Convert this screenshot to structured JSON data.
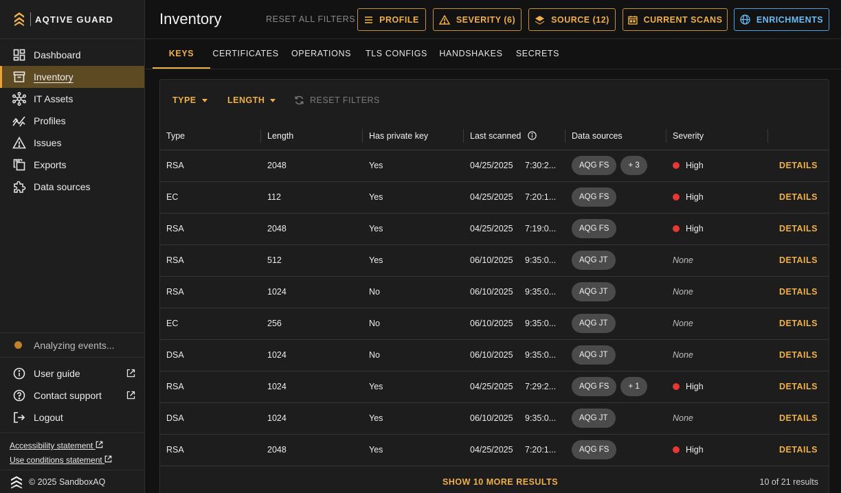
{
  "brand": {
    "name": "AQTIVE GUARD"
  },
  "sidebar": {
    "items": [
      {
        "label": "Dashboard",
        "icon": "dashboard-icon"
      },
      {
        "label": "Inventory",
        "icon": "archive-icon",
        "active": true
      },
      {
        "label": "IT Assets",
        "icon": "network-icon"
      },
      {
        "label": "Profiles",
        "icon": "chart-icon"
      },
      {
        "label": "Issues",
        "icon": "warning-icon"
      },
      {
        "label": "Exports",
        "icon": "copy-icon"
      },
      {
        "label": "Data sources",
        "icon": "puzzle-icon"
      }
    ],
    "status": "Analyzing events...",
    "bottom": [
      {
        "label": "User guide",
        "icon": "info-icon"
      },
      {
        "label": "Contact support",
        "icon": "help-icon"
      },
      {
        "label": "Logout",
        "icon": "logout-icon"
      }
    ],
    "legal": [
      "Accessibility statement",
      "Use conditions statement"
    ],
    "copyright": "© 2025 SandboxAQ"
  },
  "header": {
    "title": "Inventory",
    "reset_all": "RESET ALL FILTERS",
    "buttons": {
      "profile": "PROFILE",
      "severity": "SEVERITY (6)",
      "source": "SOURCE (12)",
      "scans": "CURRENT SCANS",
      "enrichments": "ENRICHMENTS"
    }
  },
  "tabs": [
    "KEYS",
    "CERTIFICATES",
    "OPERATIONS",
    "TLS CONFIGS",
    "HANDSHAKES",
    "SECRETS"
  ],
  "filters": {
    "type": "TYPE",
    "length": "LENGTH",
    "reset": "RESET FILTERS"
  },
  "table": {
    "columns": [
      "Type",
      "Length",
      "Has private key",
      "Last scanned",
      "Data sources",
      "Severity"
    ],
    "details_label": "DETAILS",
    "rows": [
      {
        "type": "RSA",
        "length": "2048",
        "private": "Yes",
        "date": "04/25/2025",
        "time": "7:30:2...",
        "sources": [
          "AQG FS",
          "+ 3"
        ],
        "severity": "High"
      },
      {
        "type": "EC",
        "length": "112",
        "private": "Yes",
        "date": "04/25/2025",
        "time": "7:20:1...",
        "sources": [
          "AQG FS"
        ],
        "severity": "High"
      },
      {
        "type": "RSA",
        "length": "2048",
        "private": "Yes",
        "date": "04/25/2025",
        "time": "7:19:0...",
        "sources": [
          "AQG FS"
        ],
        "severity": "High"
      },
      {
        "type": "RSA",
        "length": "512",
        "private": "Yes",
        "date": "06/10/2025",
        "time": "9:35:0...",
        "sources": [
          "AQG JT"
        ],
        "severity": "None"
      },
      {
        "type": "RSA",
        "length": "1024",
        "private": "No",
        "date": "06/10/2025",
        "time": "9:35:0...",
        "sources": [
          "AQG JT"
        ],
        "severity": "None"
      },
      {
        "type": "EC",
        "length": "256",
        "private": "No",
        "date": "06/10/2025",
        "time": "9:35:0...",
        "sources": [
          "AQG JT"
        ],
        "severity": "None"
      },
      {
        "type": "DSA",
        "length": "1024",
        "private": "No",
        "date": "06/10/2025",
        "time": "9:35:0...",
        "sources": [
          "AQG JT"
        ],
        "severity": "None"
      },
      {
        "type": "RSA",
        "length": "1024",
        "private": "Yes",
        "date": "04/25/2025",
        "time": "7:29:2...",
        "sources": [
          "AQG FS",
          "+ 1"
        ],
        "severity": "High"
      },
      {
        "type": "DSA",
        "length": "1024",
        "private": "Yes",
        "date": "06/10/2025",
        "time": "9:35:0...",
        "sources": [
          "AQG JT"
        ],
        "severity": "None"
      },
      {
        "type": "RSA",
        "length": "2048",
        "private": "Yes",
        "date": "04/25/2025",
        "time": "7:20:1...",
        "sources": [
          "AQG FS"
        ],
        "severity": "High"
      }
    ],
    "more": "SHOW 10 MORE RESULTS",
    "count": "10 of 21 results"
  },
  "colors": {
    "accent": "#f0b04a",
    "blue": "#6cbcf5",
    "high": "#e53935",
    "active_bg": "#5d4a23"
  }
}
